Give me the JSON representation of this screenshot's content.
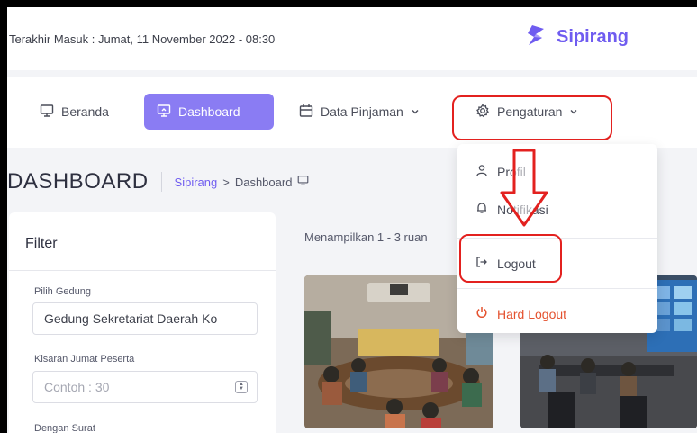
{
  "header": {
    "last_login": "Terakhir Masuk : Jumat, 11 November 2022 - 08:30",
    "brand_name": "Sipirang",
    "brand_color": "#6f5cf0"
  },
  "nav": {
    "items": [
      {
        "label": "Beranda",
        "icon": "monitor-icon"
      },
      {
        "label": "Dashboard",
        "icon": "screen-share-icon",
        "active": true
      },
      {
        "label": "Data Pinjaman",
        "icon": "calendar-icon",
        "chevron": true
      },
      {
        "label": "Pengaturan",
        "icon": "gear-icon",
        "chevron": true
      }
    ]
  },
  "page": {
    "title": "DASHBOARD",
    "breadcrumb": {
      "root": "Sipirang",
      "separator": ">",
      "current": "Dashboard"
    }
  },
  "filter": {
    "title": "Filter",
    "building_label": "Pilih Gedung",
    "building_value": "Gedung Sekretariat Daerah Ko",
    "participants_label": "Kisaran Jumat Peserta",
    "participants_placeholder": "Contoh : 30",
    "letter_label": "Dengan Surat"
  },
  "results": {
    "showing_text": "Menampilkan 1 - 3 ruan"
  },
  "settings_menu": {
    "items": [
      {
        "label": "Profil",
        "icon": "user-icon"
      },
      {
        "label": "Notifikasi",
        "icon": "bell-icon"
      },
      {
        "label": "Logout",
        "icon": "logout-icon"
      },
      {
        "label": "Hard Logout",
        "icon": "power-icon",
        "danger": true
      }
    ]
  },
  "colors": {
    "accent": "#8a7cf3",
    "annotation": "#e3211f",
    "danger": "#e4522f"
  }
}
